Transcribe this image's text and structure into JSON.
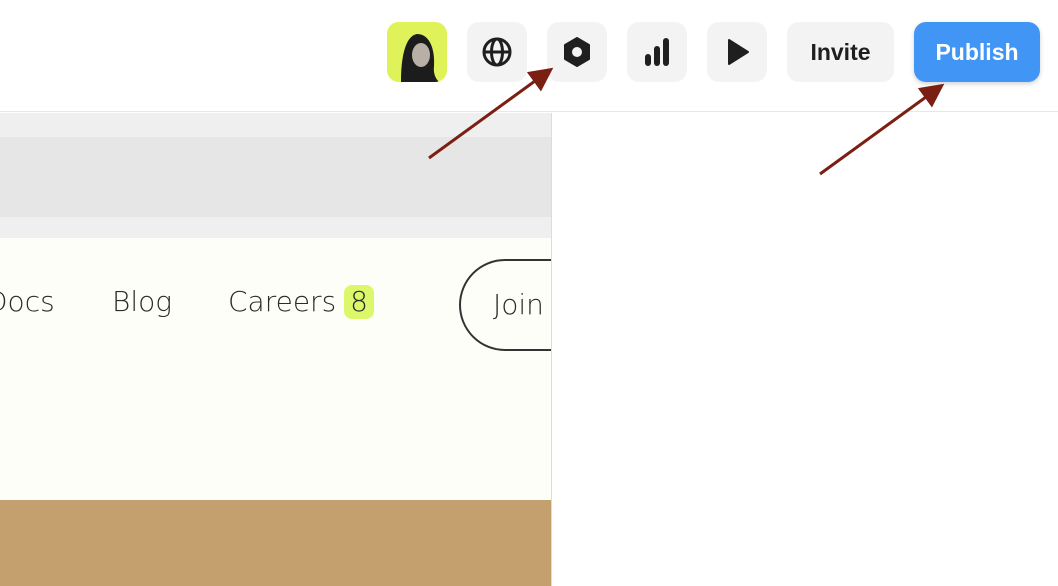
{
  "toolbar": {
    "avatar_icon": "user-avatar",
    "globe_icon": "globe-icon",
    "settings_icon": "hexagon-settings-icon",
    "analytics_icon": "bar-chart-icon",
    "preview_icon": "play-icon",
    "invite_label": "Invite",
    "publish_label": "Publish",
    "accent_color": "#4196f5"
  },
  "canvas": {
    "nav": {
      "docs_label": "Docs",
      "blog_label": "Blog",
      "careers_label": "Careers",
      "careers_badge": "8",
      "join_label": "Join",
      "badge_color": "#ddf76b"
    },
    "image_color": "#c4a06e"
  },
  "annotations": {
    "arrow_color": "#7a1f12"
  }
}
